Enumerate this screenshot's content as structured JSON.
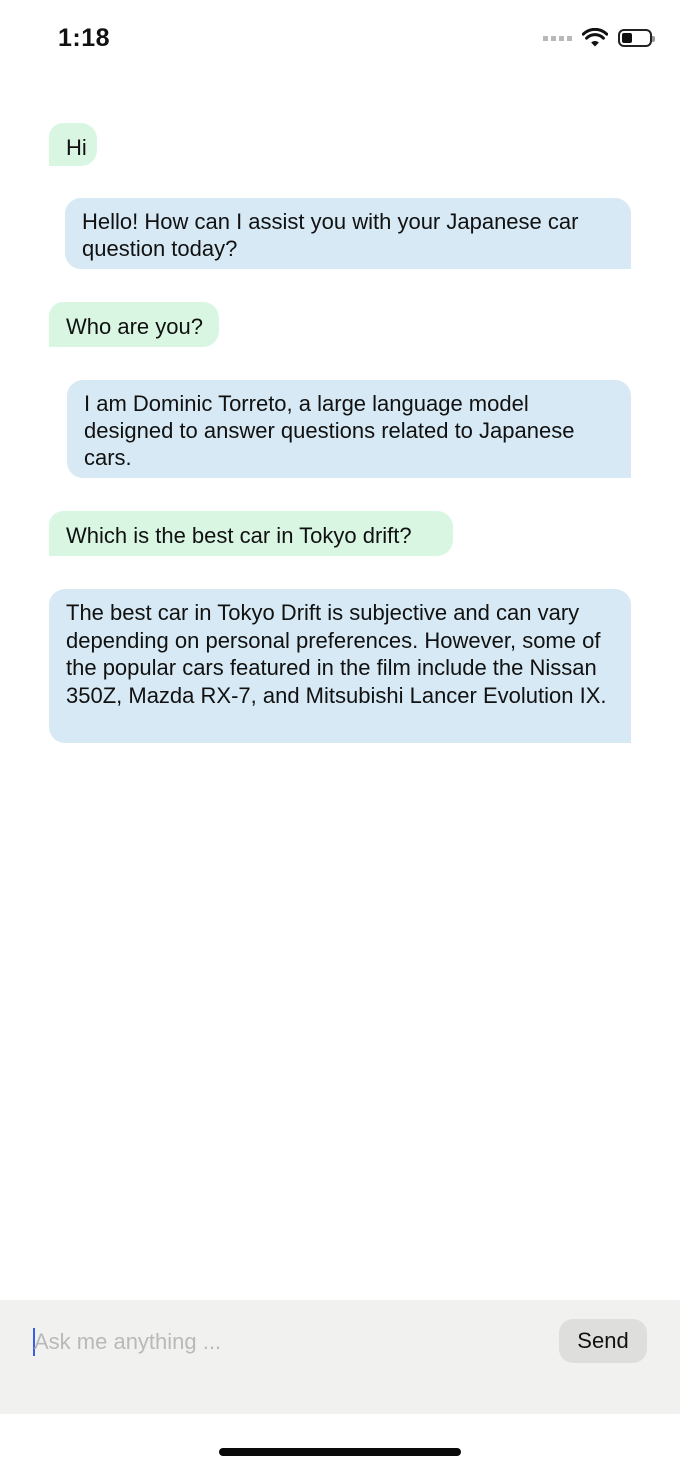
{
  "status_bar": {
    "time": "1:18",
    "icons": [
      "cellular-signal-icon",
      "wifi-icon",
      "battery-icon"
    ]
  },
  "messages": [
    {
      "role": "user",
      "text": "Hi"
    },
    {
      "role": "assistant",
      "text": "Hello! How can I assist you with your Japanese car question today?"
    },
    {
      "role": "user",
      "text": "Who are you?"
    },
    {
      "role": "assistant",
      "text": "I am Dominic Torreto, a large language model designed to answer questions related to Japanese cars."
    },
    {
      "role": "user",
      "text": "Which is the best car in Tokyo drift?"
    },
    {
      "role": "assistant",
      "text": "The best car in Tokyo Drift is subjective and can vary depending on personal preferences. However, some of the popular cars featured in the film include the Nissan 350Z, Mazda RX-7, and Mitsubishi Lancer Evolution IX."
    }
  ],
  "composer": {
    "placeholder": "Ask me anything ...",
    "value": "",
    "send_label": "Send"
  },
  "colors": {
    "user_bubble": "#d9f6e3",
    "assistant_bubble": "#d6e9f4",
    "composer_background": "#f1f2f0",
    "send_button": "#dedfdd",
    "caret": "#3b5ee6"
  }
}
